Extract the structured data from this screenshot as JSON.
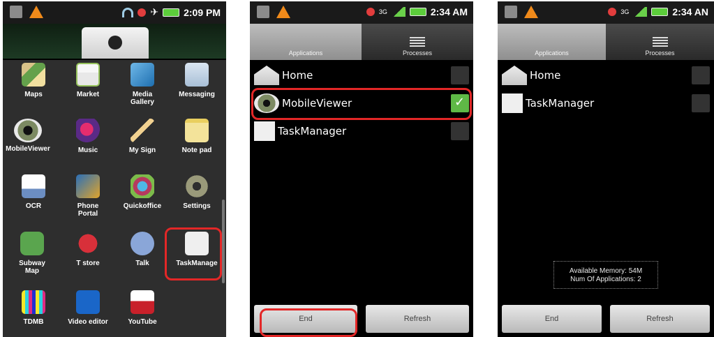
{
  "phone1": {
    "status": {
      "time": "2:09 PM"
    },
    "apps": [
      {
        "label": "Maps",
        "icon": "maps-icon"
      },
      {
        "label": "Market",
        "icon": "market-icon"
      },
      {
        "label": "Media\nGallery",
        "icon": "media-gallery-icon"
      },
      {
        "label": "Messaging",
        "icon": "messaging-icon"
      },
      {
        "label": "MobileViewer",
        "icon": "mobileviewer-icon"
      },
      {
        "label": "Music",
        "icon": "music-icon"
      },
      {
        "label": "My Sign",
        "icon": "my-sign-icon"
      },
      {
        "label": "Note pad",
        "icon": "notepad-icon"
      },
      {
        "label": "OCR",
        "icon": "ocr-icon"
      },
      {
        "label": "Phone\nPortal",
        "icon": "phone-portal-icon"
      },
      {
        "label": "Quickoffice",
        "icon": "quickoffice-icon"
      },
      {
        "label": "Settings",
        "icon": "settings-icon"
      },
      {
        "label": "Subway\nMap",
        "icon": "subway-map-icon"
      },
      {
        "label": "T store",
        "icon": "t-store-icon"
      },
      {
        "label": "Talk",
        "icon": "talk-icon"
      },
      {
        "label": "TaskManage",
        "icon": "taskmanager-icon"
      },
      {
        "label": "TDMB",
        "icon": "tdmb-icon"
      },
      {
        "label": "Video editor",
        "icon": "video-editor-icon"
      },
      {
        "label": "YouTube",
        "icon": "youtube-icon"
      }
    ]
  },
  "phone2": {
    "status": {
      "time": "2:34 AM",
      "network": "3G"
    },
    "tabs": {
      "applications": "Applications",
      "processes": "Processes"
    },
    "items": [
      {
        "name": "Home",
        "checked": false
      },
      {
        "name": "MobileViewer",
        "checked": true
      },
      {
        "name": "TaskManager",
        "checked": false
      }
    ],
    "buttons": {
      "end": "End",
      "refresh": "Refresh"
    }
  },
  "phone3": {
    "status": {
      "time": "2:34 AN",
      "network": "3G"
    },
    "tabs": {
      "applications": "Applications",
      "processes": "Processes"
    },
    "items": [
      {
        "name": "Home"
      },
      {
        "name": "TaskManager"
      }
    ],
    "memory": {
      "line1": "Available Memory: 54M",
      "line2": "Num Of Applications: 2"
    },
    "buttons": {
      "end": "End",
      "refresh": "Refresh"
    }
  },
  "colors": {
    "highlight": "#e32727",
    "check_on": "#5fb946",
    "battery": "#5ccd3b"
  }
}
